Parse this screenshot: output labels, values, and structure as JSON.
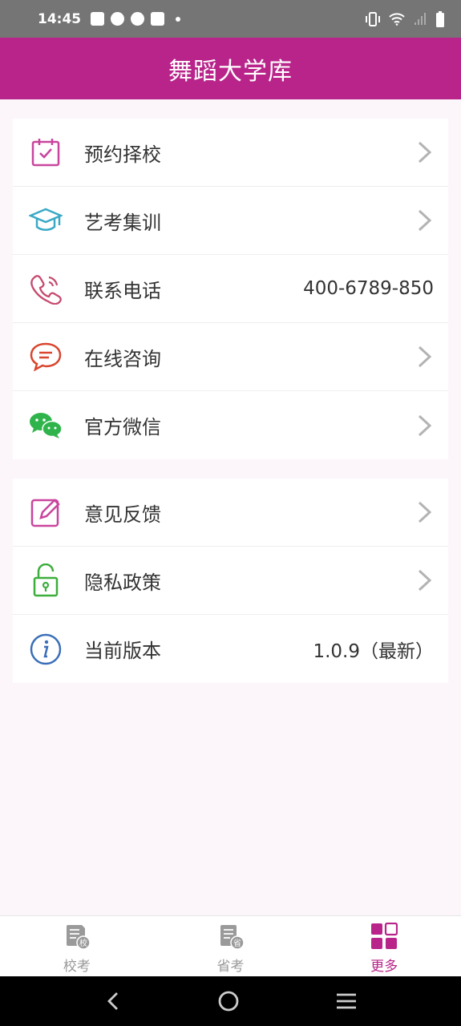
{
  "status_bar": {
    "time": "14:45"
  },
  "app_bar": {
    "title": "舞蹈大学库"
  },
  "menu_group_1": [
    {
      "label": "预约择校",
      "icon": "calendar-check-icon",
      "value": "",
      "chevron": true
    },
    {
      "label": "艺考集训",
      "icon": "graduation-cap-icon",
      "value": "",
      "chevron": true
    },
    {
      "label": "联系电话",
      "icon": "phone-icon",
      "value": "400-6789-850",
      "chevron": false
    },
    {
      "label": "在线咨询",
      "icon": "chat-bubble-icon",
      "value": "",
      "chevron": true
    },
    {
      "label": "官方微信",
      "icon": "wechat-icon",
      "value": "",
      "chevron": true
    }
  ],
  "menu_group_2": [
    {
      "label": "意见反馈",
      "icon": "edit-icon",
      "value": "",
      "chevron": true
    },
    {
      "label": "隐私政策",
      "icon": "unlock-icon",
      "value": "",
      "chevron": true
    },
    {
      "label": "当前版本",
      "icon": "info-icon",
      "value": "1.0.9（最新）",
      "chevron": false
    }
  ],
  "tabs": [
    {
      "label": "校考",
      "icon": "school-exam-icon",
      "active": false
    },
    {
      "label": "省考",
      "icon": "province-exam-icon",
      "active": false
    },
    {
      "label": "更多",
      "icon": "grid-more-icon",
      "active": true
    }
  ],
  "colors": {
    "brand": "#b8248a",
    "status_bar": "#757575",
    "background": "#fcf6fb"
  }
}
